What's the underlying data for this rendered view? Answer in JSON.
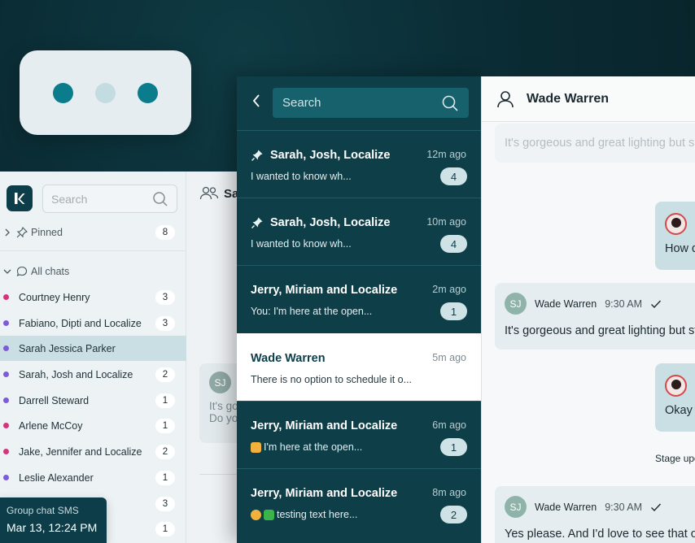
{
  "left_app": {
    "search_placeholder": "Search",
    "pinned": {
      "label": "Pinned",
      "count": "8"
    },
    "all_chats": {
      "label": "All chats"
    },
    "chats": [
      {
        "name": "Courtney Henry",
        "count": "3",
        "dot": "#d2357a"
      },
      {
        "name": "Fabiano, Dipti and Localize",
        "count": "3",
        "dot": "#7b5cd6"
      },
      {
        "name": "Sarah Jessica Parker",
        "count": "",
        "dot": "#7b5cd6"
      },
      {
        "name": "Sarah, Josh and Localize",
        "count": "2",
        "dot": "#7b5cd6"
      },
      {
        "name": "Darrell Steward",
        "count": "1",
        "dot": "#7b5cd6"
      },
      {
        "name": "Arlene McCoy",
        "count": "1",
        "dot": "#d2357a"
      },
      {
        "name": "Jake, Jennifer and Localize",
        "count": "2",
        "dot": "#d2357a"
      },
      {
        "name": "Leslie Alexander",
        "count": "1",
        "dot": "#7b5cd6"
      },
      {
        "name": "",
        "count": "3",
        "dot": ""
      },
      {
        "name": "",
        "count": "1",
        "dot": ""
      }
    ],
    "content_header": "Sa",
    "content_card": {
      "avatar": "SJ",
      "line1": "It's go",
      "line2": "Do yo"
    }
  },
  "toast": {
    "title": "Group chat SMS",
    "datetime": "Mar 13, 12:24 PM"
  },
  "chat_list": {
    "search_placeholder": "Search",
    "items": [
      {
        "title": "Sarah, Josh, Localize",
        "time": "12m ago",
        "preview": "I wanted to know wh...",
        "count": "4",
        "pinned": true
      },
      {
        "title": "Sarah, Josh, Localize",
        "time": "10m ago",
        "preview": "I wanted to know wh...",
        "count": "4",
        "pinned": true
      },
      {
        "title": "Jerry, Miriam and Localize",
        "time": "2m ago",
        "preview": "You:  I'm here at the open...",
        "count": "1"
      },
      {
        "title": "Wade Warren",
        "time": "5m ago",
        "preview": "There is no option to schedule it o...",
        "count": ""
      },
      {
        "title": "Jerry, Miriam and Localize",
        "time": "6m ago",
        "preview": "I'm here at the open...",
        "count": "1"
      },
      {
        "title": "Jerry, Miriam and Localize",
        "time": "8m ago",
        "preview": "testing text here...",
        "count": "2"
      }
    ]
  },
  "conversation": {
    "contact_name": "Wade Warren",
    "faded_message": "It's gorgeous and great lighting but s",
    "outgoing": [
      {
        "text": "How d"
      },
      {
        "text": "Okay ,"
      }
    ],
    "incoming": [
      {
        "avatar": "SJ",
        "sender": "Wade Warren",
        "time": "9:30 AM",
        "text": "It's gorgeous and great lighting but st"
      },
      {
        "avatar": "SJ",
        "sender": "Wade Warren",
        "time": "9:30 AM",
        "text": "Yes please. And I'd love to see that on"
      }
    ],
    "stage_note": "Stage upd"
  },
  "colors": {
    "brand_dark": "#0d3d48",
    "panel_teal": "#0e3f49",
    "accent_teal": "#0b7c8c",
    "highlight": "#c9dfe4"
  }
}
